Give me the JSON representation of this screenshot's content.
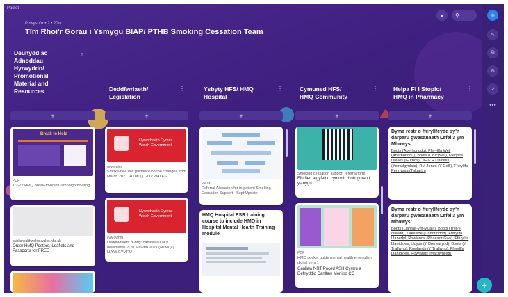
{
  "app": {
    "brand": "Padlet",
    "byline": "Powyshfrr • 2 • 20m",
    "title": "Tîm Rhoi'r Gorau i Ysmygu BIAP/ PTHB Smoking Cessation Team",
    "add_symbol": "+",
    "menu_symbol": "⋮",
    "fab_symbol": "+"
  },
  "colors": {
    "background": "#3d1f7e",
    "accent": "#22b8c4",
    "welsh_gov_red": "#d9232e"
  },
  "columns": [
    {
      "title": [
        "Deunydd ac",
        "Adnoddau",
        "Hyrwyddo/",
        "Promotional",
        "Material and",
        "Resources"
      ],
      "cards": [
        {
          "heading": "Break to Hold",
          "tag": "PDF",
          "caption": "1/2-22 HMQ Break-to-hold Campaign Briefing"
        },
        {
          "link": "publichealthwales.wales.nhs.uk",
          "caption": "Order HMQ Posters, Leaflets and Passports for FREE"
        }
      ]
    },
    {
      "title": [
        "Deddfwriaeth/",
        "Legislation"
      ],
      "cards": [
        {
          "logo_text": [
            "Llywodraeth Cymru",
            "Welsh Government"
          ],
          "tag": "gov.wales",
          "caption": "Smoke-free law guidance on the changes from March 2021 (HTML) | GOV.WALES"
        },
        {
          "logo_text": [
            "Llywodraeth Cymru",
            "Welsh Government"
          ],
          "tag": "llyw.cymru",
          "caption": "Deddfwriaeth di-fwg: canllawiau ar y newidiadau o fis Mawrth 2021 (HTML) | LLYW.CYMRU"
        }
      ]
    },
    {
      "title": [
        "Ysbyty HFS/ HMQ",
        "Hospital"
      ],
      "cards": [
        {
          "tag": "PPTX",
          "caption": "Referral Allocation for in-patient Smoking Cessation Support - Sept Update"
        },
        {
          "bold": "HMQ Hospital ESR training course to include HMQ in Hospital Mental Health Training module"
        }
      ]
    },
    {
      "title": [
        "Cymuned HFS/",
        "HMQ Community"
      ],
      "cards": [
        {
          "caption": "Smoking cessation support referral form",
          "sub": "Ffurflen atgyfeirio cymorth rhoi'r gorau i ysmygu"
        },
        {
          "tag": "PDF",
          "caption": "HMQ pocket guide mental health en english digital vers 1",
          "sub": "Canllaw NRT Poced ASH Cymru a Defnyddio Canllaw Monitro CO"
        }
      ]
    },
    {
      "title": [
        "Helpa Fi I Stopio/",
        "HMQ in Pharmacy"
      ],
      "cards": [
        {
          "bold": "Dyma restr o fferyllfeydd sy'n darparu gwasanaeth Lefel 3 ym Mhowys:",
          "links": "Boots (Aberhonddu), Fferyllfa Well (Aberhonddu), Boots (Crucywel), Fferyllfa Davies (Gurnos), JG & RJ Davies (Ystradgynlais), RM Jones (Y Gelli), Fferyllfa Pennyssa (Talgarth)"
        },
        {
          "bold": "Dyma restr o fferyllfeydd sy'n darparu gwasanaeth Lefel 3 ym Mhowys:",
          "links": "Boots (Llanfair-ym-Muallt), Boots (Tref-y-clawdd), Lakeside (Llandrindod), Fferyllfa Llanerfyl, Rowlands (Rhaeadr Gwy), Fferyllfa Llanidloes, Lloyds (Y Drenewydd), Boots (Y Trallwng), Rowlands (Y Trallwng), Fferyllfa Llanidloes, Rowlands (Machynlleth)"
        }
      ]
    }
  ]
}
